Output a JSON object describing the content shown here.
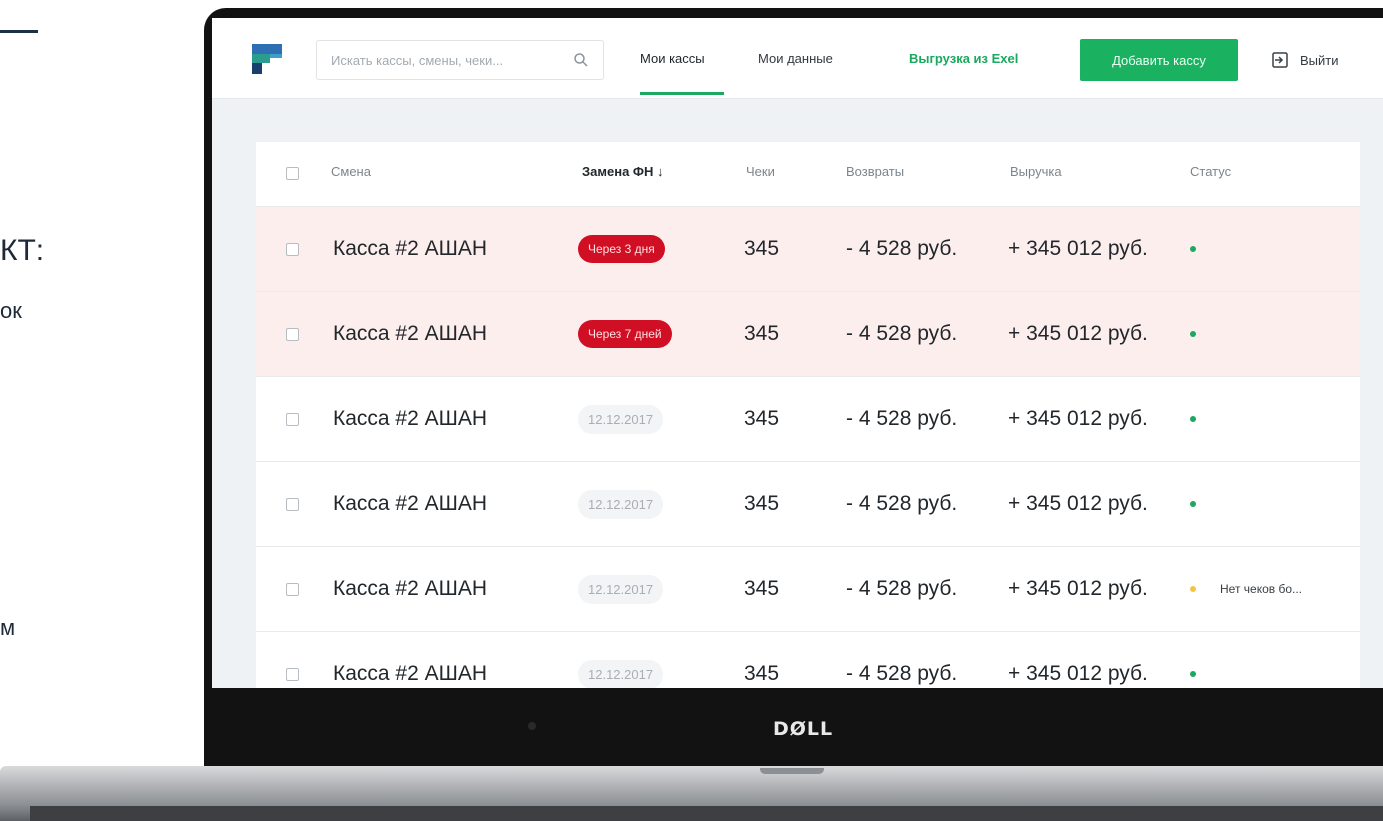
{
  "slide": {
    "fragment1": "КТ:",
    "fragment2": "ок",
    "fragment3": "м"
  },
  "device": {
    "brand": "DØLL"
  },
  "header": {
    "search_placeholder": "Искать кассы, смены, чеки...",
    "nav": [
      "Мои кассы",
      "Мои данные"
    ],
    "active_nav": "Мои кассы",
    "export_label": "Выгрузка из Exel",
    "add_button": "Добавить кассу",
    "logout_label": "Выйти"
  },
  "colors": {
    "accent_green": "#1ab161",
    "alert_red": "#d10f24",
    "alert_row_bg": "#fdeeee",
    "status_ok": "#1aa95e",
    "status_warning": "#f4c542"
  },
  "table": {
    "columns": [
      "Смена",
      "Замена ФН ↓",
      "Чеки",
      "Возвраты",
      "Выручка",
      "Статус"
    ],
    "sorted_column": "Замена ФН",
    "rows": [
      {
        "name": "Касса #2 АШАН",
        "fn": "Через 3 дня",
        "fn_type": "alert",
        "checks": "345",
        "returns": "- 4 528 руб.",
        "revenue": "+ 345 012 руб.",
        "status": "ok",
        "status_text": ""
      },
      {
        "name": "Касса #2 АШАН",
        "fn": "Через 7 дней",
        "fn_type": "alert",
        "checks": "345",
        "returns": "- 4 528 руб.",
        "revenue": "+ 345 012 руб.",
        "status": "ok",
        "status_text": ""
      },
      {
        "name": "Касса #2 АШАН",
        "fn": "12.12.2017",
        "fn_type": "date",
        "checks": "345",
        "returns": "- 4 528 руб.",
        "revenue": "+ 345 012 руб.",
        "status": "ok",
        "status_text": ""
      },
      {
        "name": "Касса #2 АШАН",
        "fn": "12.12.2017",
        "fn_type": "date",
        "checks": "345",
        "returns": "- 4 528 руб.",
        "revenue": "+ 345 012 руб.",
        "status": "ok",
        "status_text": ""
      },
      {
        "name": "Касса #2 АШАН",
        "fn": "12.12.2017",
        "fn_type": "date",
        "checks": "345",
        "returns": "- 4 528 руб.",
        "revenue": "+ 345 012 руб.",
        "status": "warning",
        "status_text": "Нет чеков бо..."
      },
      {
        "name": "Касса #2 АШАН",
        "fn": "12.12.2017",
        "fn_type": "date",
        "checks": "345",
        "returns": "- 4 528 руб.",
        "revenue": "+ 345 012 руб.",
        "status": "ok",
        "status_text": ""
      }
    ]
  }
}
